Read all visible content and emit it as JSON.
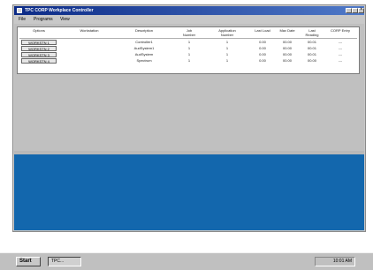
{
  "window": {
    "title": "TPC CORP Workplace Controller"
  },
  "menu": [
    "File",
    "Programs",
    "View"
  ],
  "table": {
    "headers": [
      "Options",
      "Workstation",
      "Description",
      "Job Number",
      "Application Number",
      "Last Load",
      "Max Date",
      "Last Reading",
      "CORP Entry"
    ],
    "rows": [
      [
        "WORKSTN 1",
        "",
        "Controller1",
        "1",
        "1",
        "0.00",
        "00.00",
        "00.01",
        "---"
      ],
      [
        "WORKSTN 2",
        "",
        "AudSystem1",
        "1",
        "1",
        "0.00",
        "00.00",
        "00.01",
        "---"
      ],
      [
        "WORKSTN 3",
        "",
        "AudSystem",
        "1",
        "1",
        "0.00",
        "00.00",
        "00.01",
        "---"
      ],
      [
        "WORKSTN 4",
        "",
        "Spectrum",
        "1",
        "1",
        "0.00",
        "00.00",
        "00.00",
        "---"
      ]
    ]
  },
  "taskbar": {
    "start": "Start",
    "task": "TPC...",
    "clock": "10:01 AM"
  },
  "colors": {
    "titlebar": "#0b2a86",
    "blue_area": "#1367ad",
    "chrome": "#c0c0c0"
  }
}
